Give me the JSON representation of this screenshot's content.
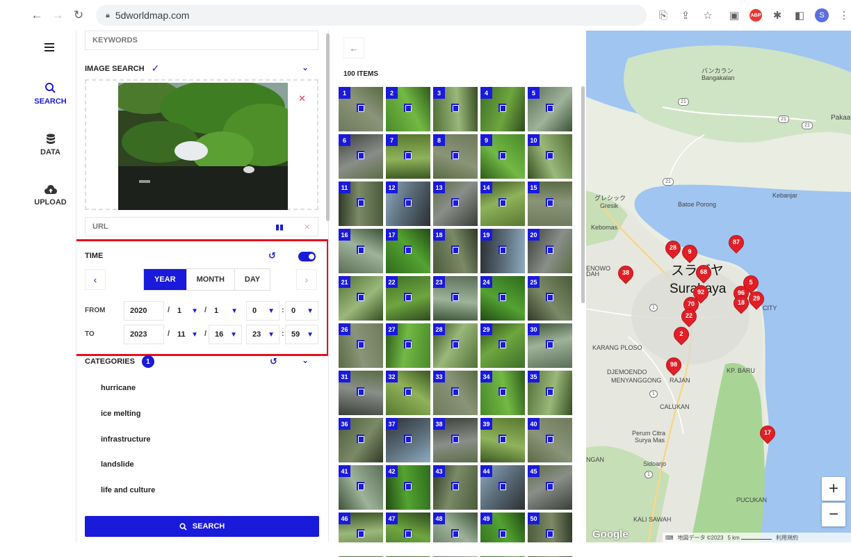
{
  "browser": {
    "url": "5dworldmap.com",
    "icons": [
      "back-arrow-icon",
      "forward-arrow-icon",
      "reload-icon",
      "translate-icon",
      "share-icon",
      "star-icon",
      "extension-icon",
      "abp-icon",
      "puzzle-icon",
      "sidepanel-icon",
      "profile-avatar",
      "kebab-menu-icon"
    ],
    "abp_label": "ABP",
    "avatar_letter": "S"
  },
  "leftnav": {
    "items": [
      {
        "label": "SEARCH",
        "icon": "search-icon",
        "active": true
      },
      {
        "label": "DATA",
        "icon": "database-icon",
        "active": false
      },
      {
        "label": "UPLOAD",
        "icon": "cloud-upload-icon",
        "active": false
      }
    ]
  },
  "search_panel": {
    "keywords_placeholder": "KEYWORDS",
    "image_search_title": "IMAGE SEARCH",
    "url_placeholder": "URL",
    "time": {
      "title": "TIME",
      "enabled": true,
      "tabs": [
        "YEAR",
        "MONTH",
        "DAY"
      ],
      "active_tab": "YEAR",
      "from_label": "FROM",
      "to_label": "TO",
      "from": {
        "year": "2020",
        "month": "1",
        "day": "1",
        "hour": "0",
        "minute": "0"
      },
      "to": {
        "year": "2023",
        "month": "11",
        "day": "16",
        "hour": "23",
        "minute": "59"
      }
    },
    "categories": {
      "title": "CATEGORIES",
      "count": "1",
      "items": [
        "hurricane",
        "ice melting",
        "infrastructure",
        "landslide",
        "life and culture"
      ]
    },
    "search_button": "SEARCH"
  },
  "results": {
    "count_label": "100 ITEMS",
    "thumbnails": [
      "1",
      "2",
      "3",
      "4",
      "5",
      "6",
      "7",
      "8",
      "9",
      "10",
      "11",
      "12",
      "13",
      "14",
      "15",
      "16",
      "17",
      "18",
      "19",
      "20",
      "21",
      "22",
      "23",
      "24",
      "25",
      "26",
      "27",
      "28",
      "29",
      "30",
      "31",
      "32",
      "33",
      "34",
      "35",
      "36",
      "37",
      "38",
      "39",
      "40",
      "41",
      "42",
      "43",
      "44",
      "45",
      "46",
      "47",
      "48",
      "49",
      "50"
    ]
  },
  "map": {
    "labels": [
      "バンカラン",
      "Bangakalan",
      "Pakaa",
      "Kebanjar",
      "グレシック",
      "Gresik",
      "Batoe Porong",
      "Kebomas",
      "ENOWO",
      "DAH",
      "スラバヤ",
      "Surabaya",
      "CITY",
      "KARANG PLOSO",
      "DJEMOENDO",
      "MENYANGGONG",
      "RAJAN",
      "KP. BARU",
      "CALUKAN",
      "Perum Citra",
      "Surya Mas",
      "NGAN",
      "Sidoarjo",
      "PUCUKAN",
      "KALI SAWAH"
    ],
    "road_shields": [
      "21",
      "21",
      "21",
      "21",
      "1",
      "1",
      "1"
    ],
    "pins": [
      "28",
      "9",
      "87",
      "38",
      "68",
      "92",
      "96",
      "5",
      "29",
      "70",
      "18",
      "22",
      "2",
      "98",
      "17"
    ],
    "google": "Google",
    "attribution": {
      "keyboard": "⌨",
      "data": "地図データ ©2023",
      "scale": "5 km",
      "terms": "利用規約"
    },
    "zoom_in": "+",
    "zoom_out": "−"
  }
}
